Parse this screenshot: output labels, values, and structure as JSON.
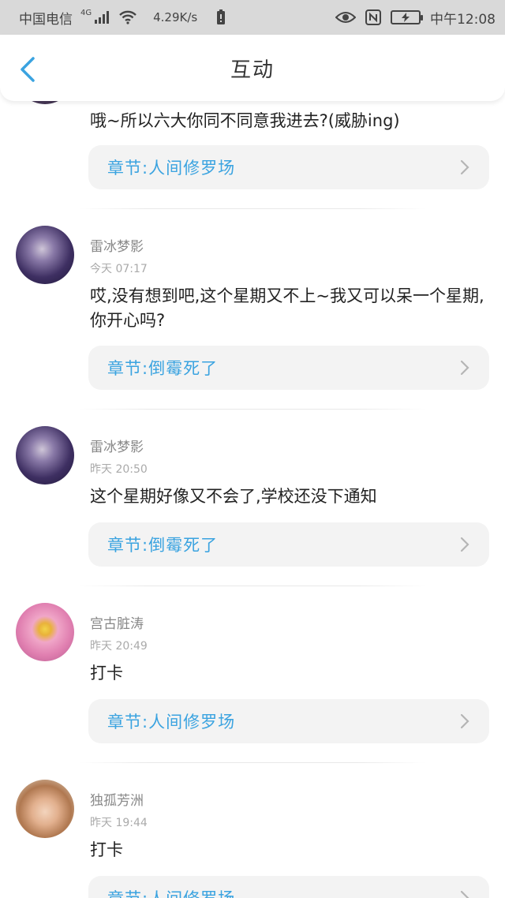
{
  "status_bar": {
    "carrier": "中国电信",
    "network": "4G",
    "speed": "4.29K/s",
    "time": "中午12:08"
  },
  "header": {
    "title": "互动",
    "back_icon": "chevron-left-icon"
  },
  "colors": {
    "accent": "#3aa3e0",
    "chapter_bg": "#f3f3f3"
  },
  "comments": [
    {
      "content": "哦~所以六大你同不同意我进去?(威胁ing)",
      "chapter": "章节:人间修罗场"
    },
    {
      "user": "雷冰梦影",
      "time": "今天 07:17",
      "content": "哎,没有想到吧,这个星期又不上~我又可以呆一个星期,你开心吗?",
      "chapter": "章节:倒霉死了"
    },
    {
      "user": "雷冰梦影",
      "time": "昨天 20:50",
      "content": "这个星期好像又不会了,学校还没下通知",
      "chapter": "章节:倒霉死了"
    },
    {
      "user": "宫古脏涛",
      "time": "昨天 20:49",
      "content": "打卡",
      "chapter": "章节:人间修罗场"
    },
    {
      "user": "独孤芳洲",
      "time": "昨天 19:44",
      "content": "打卡",
      "chapter": "章节:人间修罗场"
    }
  ]
}
